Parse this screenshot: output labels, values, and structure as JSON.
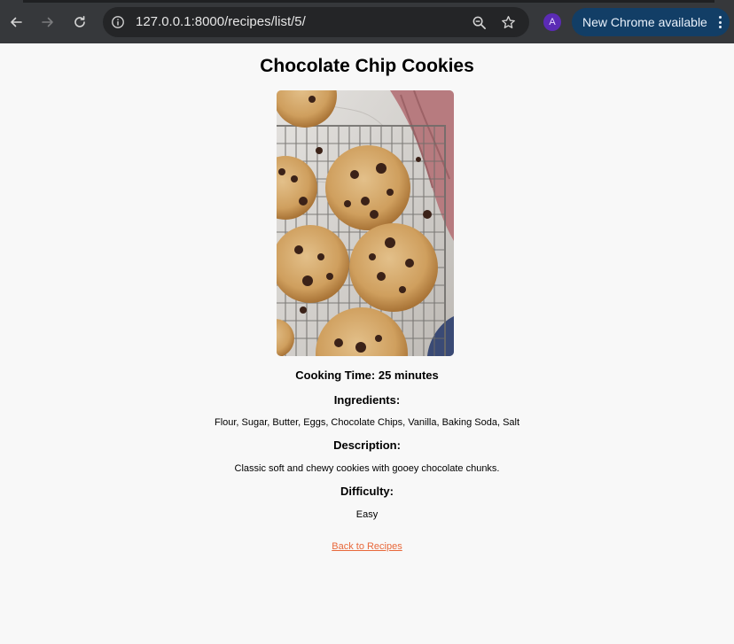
{
  "browser": {
    "url_host": "127.0.0.1",
    "url_rest": ":8000/recipes/list/5/",
    "avatar_initial": "A",
    "update_label": "New Chrome available"
  },
  "recipe": {
    "title": "Chocolate Chip Cookies",
    "image_alt": "Chocolate chip cookies on a cooling rack",
    "cooking_time": "Cooking Time: 25 minutes",
    "ingredients_heading": "Ingredients:",
    "ingredients": "Flour, Sugar, Butter, Eggs, Chocolate Chips, Vanilla, Baking Soda, Salt",
    "description_heading": "Description:",
    "description": "Classic soft and chewy cookies with gooey chocolate chunks.",
    "difficulty_heading": "Difficulty:",
    "difficulty": "Easy",
    "back_link": "Back to Recipes"
  },
  "colors": {
    "toolbar": "#36383b",
    "omnibox": "#242527",
    "update_pill": "#123e66",
    "link": "#e8683a",
    "page_bg": "#f8f8f8"
  }
}
